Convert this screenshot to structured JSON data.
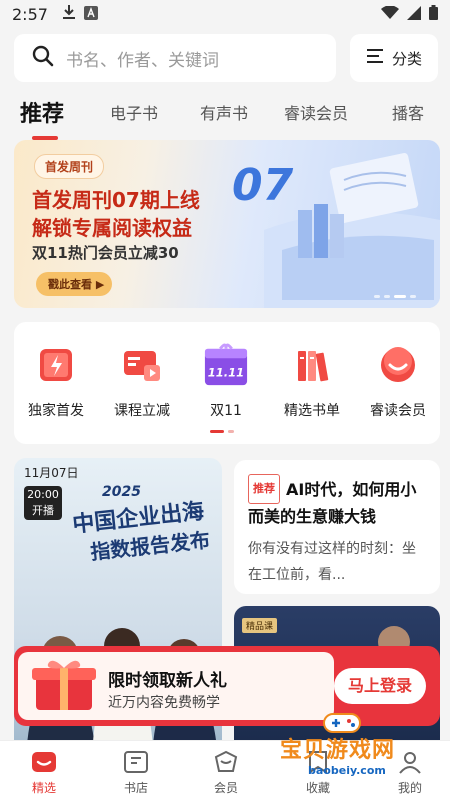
{
  "status_bar": {
    "time": "2:57",
    "icons": [
      "download-icon",
      "a-icon",
      "wifi-icon",
      "signal-icon",
      "battery-icon"
    ]
  },
  "search": {
    "placeholder": "书名、作者、关键词",
    "category_label": "分类"
  },
  "tabs": [
    "推荐",
    "电子书",
    "有声书",
    "睿读会员",
    "播客"
  ],
  "banner": {
    "tag": "首发周刊",
    "line1": "首发周刊07期上线",
    "line2": "解锁专属阅读权益",
    "sub": "双11热门会员立减30",
    "cta": "戳此查看 ▶",
    "number": "07"
  },
  "entries": [
    {
      "label": "独家首发",
      "icon": "book-flash-icon"
    },
    {
      "label": "课程立减",
      "icon": "course-icon"
    },
    {
      "label": "双11",
      "icon": "gift-1111-icon"
    },
    {
      "label": "精选书单",
      "icon": "booklist-icon"
    },
    {
      "label": "睿读会员",
      "icon": "smile-member-icon"
    }
  ],
  "live": {
    "date": "11月07日",
    "time": "20:00",
    "status": "开播",
    "year": "2025",
    "title1": "中国企业出海",
    "title2": "指数报告发布"
  },
  "article": {
    "tag": "推荐",
    "title": "AI时代，如何用小而美的生意赚大钱",
    "desc": "你有没有过这样的时刻：坐在工位前，看..."
  },
  "course": {
    "tag": "精品课"
  },
  "promo": {
    "title": "限时领取新人礼",
    "sub": "近万内容免费畅学",
    "button": "马上登录"
  },
  "bottom_nav": [
    "精选",
    "书店",
    "会员",
    "收藏",
    "我的"
  ],
  "watermark": {
    "cn": "宝贝游戏网",
    "en": "baobeiy.com"
  },
  "colors": {
    "accent": "#e53935",
    "banner_text": "#c62a17",
    "banner_number": "#2c6ad9"
  }
}
